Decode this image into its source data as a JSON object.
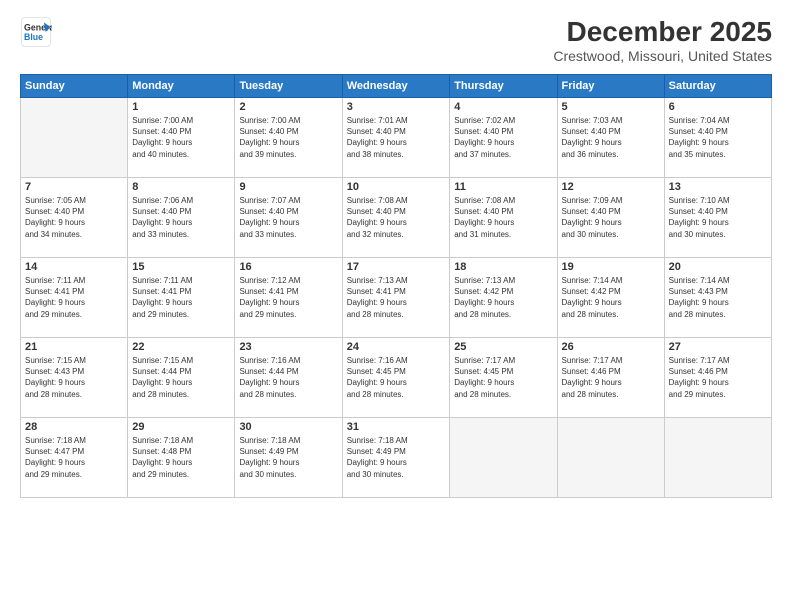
{
  "logo": {
    "line1": "General",
    "line2": "Blue"
  },
  "title": "December 2025",
  "subtitle": "Crestwood, Missouri, United States",
  "days_of_week": [
    "Sunday",
    "Monday",
    "Tuesday",
    "Wednesday",
    "Thursday",
    "Friday",
    "Saturday"
  ],
  "weeks": [
    [
      {
        "day": "",
        "info": ""
      },
      {
        "day": "1",
        "info": "Sunrise: 7:00 AM\nSunset: 4:40 PM\nDaylight: 9 hours\nand 40 minutes."
      },
      {
        "day": "2",
        "info": "Sunrise: 7:00 AM\nSunset: 4:40 PM\nDaylight: 9 hours\nand 39 minutes."
      },
      {
        "day": "3",
        "info": "Sunrise: 7:01 AM\nSunset: 4:40 PM\nDaylight: 9 hours\nand 38 minutes."
      },
      {
        "day": "4",
        "info": "Sunrise: 7:02 AM\nSunset: 4:40 PM\nDaylight: 9 hours\nand 37 minutes."
      },
      {
        "day": "5",
        "info": "Sunrise: 7:03 AM\nSunset: 4:40 PM\nDaylight: 9 hours\nand 36 minutes."
      },
      {
        "day": "6",
        "info": "Sunrise: 7:04 AM\nSunset: 4:40 PM\nDaylight: 9 hours\nand 35 minutes."
      }
    ],
    [
      {
        "day": "7",
        "info": "Sunrise: 7:05 AM\nSunset: 4:40 PM\nDaylight: 9 hours\nand 34 minutes."
      },
      {
        "day": "8",
        "info": "Sunrise: 7:06 AM\nSunset: 4:40 PM\nDaylight: 9 hours\nand 33 minutes."
      },
      {
        "day": "9",
        "info": "Sunrise: 7:07 AM\nSunset: 4:40 PM\nDaylight: 9 hours\nand 33 minutes."
      },
      {
        "day": "10",
        "info": "Sunrise: 7:08 AM\nSunset: 4:40 PM\nDaylight: 9 hours\nand 32 minutes."
      },
      {
        "day": "11",
        "info": "Sunrise: 7:08 AM\nSunset: 4:40 PM\nDaylight: 9 hours\nand 31 minutes."
      },
      {
        "day": "12",
        "info": "Sunrise: 7:09 AM\nSunset: 4:40 PM\nDaylight: 9 hours\nand 30 minutes."
      },
      {
        "day": "13",
        "info": "Sunrise: 7:10 AM\nSunset: 4:40 PM\nDaylight: 9 hours\nand 30 minutes."
      }
    ],
    [
      {
        "day": "14",
        "info": "Sunrise: 7:11 AM\nSunset: 4:41 PM\nDaylight: 9 hours\nand 29 minutes."
      },
      {
        "day": "15",
        "info": "Sunrise: 7:11 AM\nSunset: 4:41 PM\nDaylight: 9 hours\nand 29 minutes."
      },
      {
        "day": "16",
        "info": "Sunrise: 7:12 AM\nSunset: 4:41 PM\nDaylight: 9 hours\nand 29 minutes."
      },
      {
        "day": "17",
        "info": "Sunrise: 7:13 AM\nSunset: 4:41 PM\nDaylight: 9 hours\nand 28 minutes."
      },
      {
        "day": "18",
        "info": "Sunrise: 7:13 AM\nSunset: 4:42 PM\nDaylight: 9 hours\nand 28 minutes."
      },
      {
        "day": "19",
        "info": "Sunrise: 7:14 AM\nSunset: 4:42 PM\nDaylight: 9 hours\nand 28 minutes."
      },
      {
        "day": "20",
        "info": "Sunrise: 7:14 AM\nSunset: 4:43 PM\nDaylight: 9 hours\nand 28 minutes."
      }
    ],
    [
      {
        "day": "21",
        "info": "Sunrise: 7:15 AM\nSunset: 4:43 PM\nDaylight: 9 hours\nand 28 minutes."
      },
      {
        "day": "22",
        "info": "Sunrise: 7:15 AM\nSunset: 4:44 PM\nDaylight: 9 hours\nand 28 minutes."
      },
      {
        "day": "23",
        "info": "Sunrise: 7:16 AM\nSunset: 4:44 PM\nDaylight: 9 hours\nand 28 minutes."
      },
      {
        "day": "24",
        "info": "Sunrise: 7:16 AM\nSunset: 4:45 PM\nDaylight: 9 hours\nand 28 minutes."
      },
      {
        "day": "25",
        "info": "Sunrise: 7:17 AM\nSunset: 4:45 PM\nDaylight: 9 hours\nand 28 minutes."
      },
      {
        "day": "26",
        "info": "Sunrise: 7:17 AM\nSunset: 4:46 PM\nDaylight: 9 hours\nand 28 minutes."
      },
      {
        "day": "27",
        "info": "Sunrise: 7:17 AM\nSunset: 4:46 PM\nDaylight: 9 hours\nand 29 minutes."
      }
    ],
    [
      {
        "day": "28",
        "info": "Sunrise: 7:18 AM\nSunset: 4:47 PM\nDaylight: 9 hours\nand 29 minutes."
      },
      {
        "day": "29",
        "info": "Sunrise: 7:18 AM\nSunset: 4:48 PM\nDaylight: 9 hours\nand 29 minutes."
      },
      {
        "day": "30",
        "info": "Sunrise: 7:18 AM\nSunset: 4:49 PM\nDaylight: 9 hours\nand 30 minutes."
      },
      {
        "day": "31",
        "info": "Sunrise: 7:18 AM\nSunset: 4:49 PM\nDaylight: 9 hours\nand 30 minutes."
      },
      {
        "day": "",
        "info": ""
      },
      {
        "day": "",
        "info": ""
      },
      {
        "day": "",
        "info": ""
      }
    ]
  ]
}
